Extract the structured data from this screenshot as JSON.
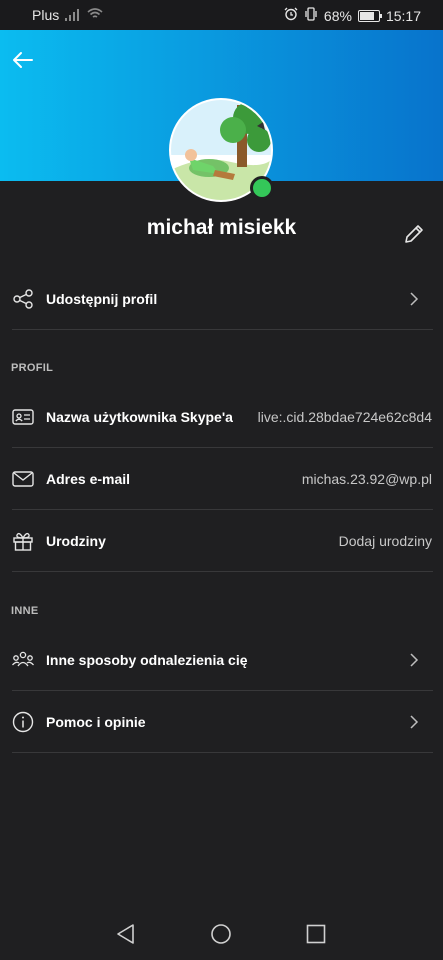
{
  "status": {
    "carrier": "Plus",
    "battery": "68%",
    "time": "15:17",
    "battery_level": 0.68
  },
  "profile": {
    "name": "michał misiekk",
    "presence": "online",
    "presence_color": "#34c759"
  },
  "header": {
    "gradient_start": "#0bbcf0",
    "gradient_end": "#0873cc"
  },
  "share": {
    "label": "Udostępnij profil"
  },
  "sections": {
    "profil": "PROFIL",
    "inne": "INNE"
  },
  "profil_rows": {
    "username": {
      "label": "Nazwa użytkownika Skype'a",
      "value": "live:.cid.28bdae724e62c8d4"
    },
    "email": {
      "label": "Adres e-mail",
      "value": "michas.23.92@wp.pl"
    },
    "birthday": {
      "label": "Urodziny",
      "value": "Dodaj urodziny"
    }
  },
  "inne_rows": {
    "find": {
      "label": "Inne sposoby odnalezienia cię"
    },
    "help": {
      "label": "Pomoc i opinie"
    }
  }
}
